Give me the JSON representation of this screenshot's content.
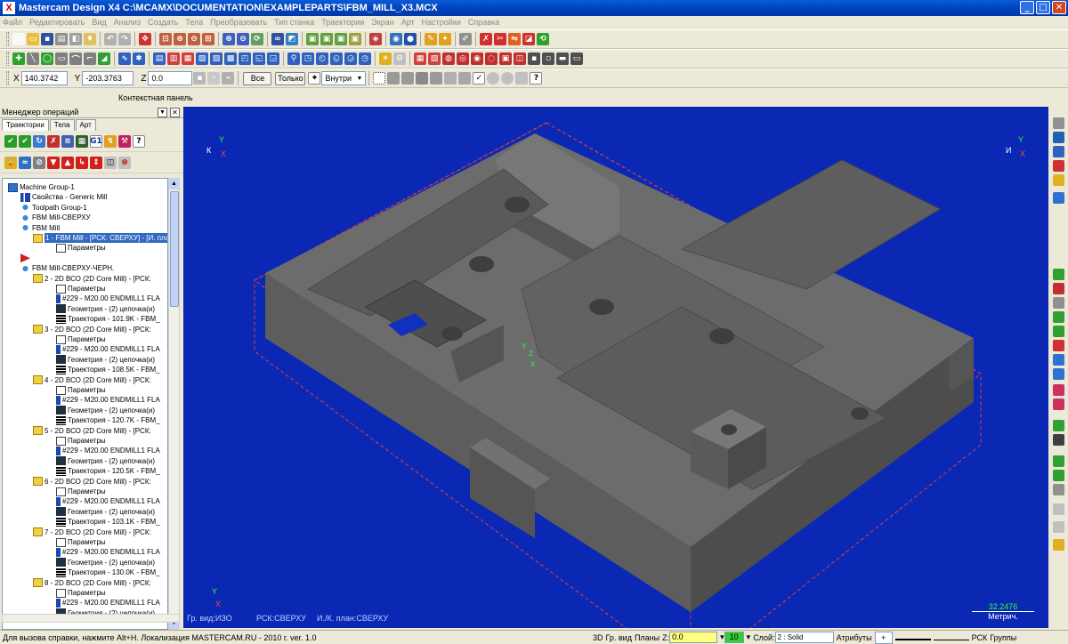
{
  "window": {
    "logo": "X",
    "title": "Mastercam Design X4  C:\\MCAMX\\DOCUMENTATION\\EXAMPLEPARTS\\FBM_MILL_X3.MCX",
    "minimize": "_",
    "maximize": "□",
    "close": "✕"
  },
  "menu": [
    "Файл",
    "Редактировать",
    "Вид",
    "Анализ",
    "Создать",
    "Тела",
    "Преобразовать",
    "Тип станка",
    "Траектории",
    "Экран",
    "Арт",
    "Настройки",
    "Справка"
  ],
  "coords": {
    "x_label": "X",
    "x_value": "140.3742",
    "y_label": "Y",
    "y_value": "-203.3763",
    "z_label": "Z",
    "z_value": "0.0",
    "all_button": "Все",
    "only_button": "Только",
    "inside_select": "Внутри"
  },
  "context_panel": "Контекстная панель",
  "ops_manager": {
    "title": "Менеджер операций",
    "tabs": [
      "Траектории",
      "Тела",
      "Арт"
    ],
    "tree": [
      {
        "level": 0,
        "icon": "group",
        "text": "Machine Group-1"
      },
      {
        "level": 1,
        "icon": "props",
        "text": "Свойства - Generic Mill"
      },
      {
        "level": 1,
        "icon": "tpgroup",
        "text": "Toolpath Group-1"
      },
      {
        "level": 1,
        "icon": "tpgroup",
        "text": "FBM Mill-СВЕРХУ"
      },
      {
        "level": 1,
        "icon": "tpgroup",
        "text": "FBM Mill"
      },
      {
        "level": 2,
        "icon": "folder",
        "text": "1 - FBM Mill - [РСК: СВЕРХУ] - [И. пла",
        "selected": true
      },
      {
        "level": 3,
        "icon": "params",
        "text": "Параметры"
      },
      {
        "level": 1,
        "icon": "marker",
        "text": ""
      },
      {
        "level": 1,
        "icon": "tpgroup",
        "text": "FBM Mill-СВЕРХУ-ЧЕРН."
      },
      {
        "level": 2,
        "icon": "folder",
        "text": "2 - 2D ВСО (2D Core Mill) - [РСК:"
      },
      {
        "level": 3,
        "icon": "params",
        "text": "Параметры"
      },
      {
        "level": 3,
        "icon": "tool",
        "text": "#229 - M20.00 ENDMILL1 FLA"
      },
      {
        "level": 3,
        "icon": "geom",
        "text": "Геометрия - (2) цепочка(и)"
      },
      {
        "level": 3,
        "icon": "path",
        "text": "Траектория - 101.9K - FBM_"
      },
      {
        "level": 2,
        "icon": "folder",
        "text": "3 - 2D ВСО (2D Core Mill) - [РСК:"
      },
      {
        "level": 3,
        "icon": "params",
        "text": "Параметры"
      },
      {
        "level": 3,
        "icon": "tool",
        "text": "#229 - M20.00 ENDMILL1 FLA"
      },
      {
        "level": 3,
        "icon": "geom",
        "text": "Геометрия - (2) цепочка(и)"
      },
      {
        "level": 3,
        "icon": "path",
        "text": "Траектория - 108.5K - FBM_"
      },
      {
        "level": 2,
        "icon": "folder",
        "text": "4 - 2D ВСО (2D Core Mill) - [РСК:"
      },
      {
        "level": 3,
        "icon": "params",
        "text": "Параметры"
      },
      {
        "level": 3,
        "icon": "tool",
        "text": "#229 - M20.00 ENDMILL1 FLA"
      },
      {
        "level": 3,
        "icon": "geom",
        "text": "Геометрия - (2) цепочка(и)"
      },
      {
        "level": 3,
        "icon": "path",
        "text": "Траектория - 120.7K - FBM_"
      },
      {
        "level": 2,
        "icon": "folder",
        "text": "5 - 2D ВСО (2D Core Mill) - [РСК:"
      },
      {
        "level": 3,
        "icon": "params",
        "text": "Параметры"
      },
      {
        "level": 3,
        "icon": "tool",
        "text": "#229 - M20.00 ENDMILL1 FLA"
      },
      {
        "level": 3,
        "icon": "geom",
        "text": "Геометрия - (2) цепочка(и)"
      },
      {
        "level": 3,
        "icon": "path",
        "text": "Траектория - 120.5K - FBM_"
      },
      {
        "level": 2,
        "icon": "folder",
        "text": "6 - 2D ВСО (2D Core Mill) - [РСК:"
      },
      {
        "level": 3,
        "icon": "params",
        "text": "Параметры"
      },
      {
        "level": 3,
        "icon": "tool",
        "text": "#229 - M20.00 ENDMILL1 FLA"
      },
      {
        "level": 3,
        "icon": "geom",
        "text": "Геометрия - (2) цепочка(и)"
      },
      {
        "level": 3,
        "icon": "path",
        "text": "Траектория - 103.1K - FBM_"
      },
      {
        "level": 2,
        "icon": "folder",
        "text": "7 - 2D ВСО (2D Core Mill) - [РСК:"
      },
      {
        "level": 3,
        "icon": "params",
        "text": "Параметры"
      },
      {
        "level": 3,
        "icon": "tool",
        "text": "#229 - M20.00 ENDMILL1 FLA"
      },
      {
        "level": 3,
        "icon": "geom",
        "text": "Геометрия - (2) цепочка(и)"
      },
      {
        "level": 3,
        "icon": "path",
        "text": "Траектория - 130.0K - FBM_"
      },
      {
        "level": 2,
        "icon": "folder",
        "text": "8 - 2D ВСО (2D Core Mill) - [РСК:"
      },
      {
        "level": 3,
        "icon": "params",
        "text": "Параметры"
      },
      {
        "level": 3,
        "icon": "tool",
        "text": "#229 - M20.00 ENDMILL1 FLA"
      },
      {
        "level": 3,
        "icon": "geom",
        "text": "Геометрия - (2) цепочка(и)"
      }
    ]
  },
  "viewport": {
    "gview": "Гр. вид:ИЗО",
    "rsk": "РСК:СВЕРХУ",
    "plane": "И./К. план:СВЕРХУ",
    "scale_value": "32.2476",
    "scale_unit": "Метрич.",
    "triad_tl": "К",
    "triad_tr": "И",
    "axis_x": "X",
    "axis_y": "Y",
    "axis_z": "Z"
  },
  "status": {
    "help": "Для вызова справки, нажмите Alt+H. Локализация MASTERCAM.RU - 2010 г. ver. 1.0",
    "mode_3d": "3D",
    "gview": "Гр. вид",
    "planes": "Планы",
    "z_label": "Z:",
    "z_value": "0.0",
    "level_value": "10",
    "layer_label": "Слой:",
    "layer_value": "2 : Solid",
    "attributes": "Атрибуты",
    "rsk": "РСК",
    "groups": "Группы"
  },
  "colors": {
    "viewport_bg": "#0a28b4",
    "part": "#6c6c6c",
    "selection": "#316ac5"
  }
}
